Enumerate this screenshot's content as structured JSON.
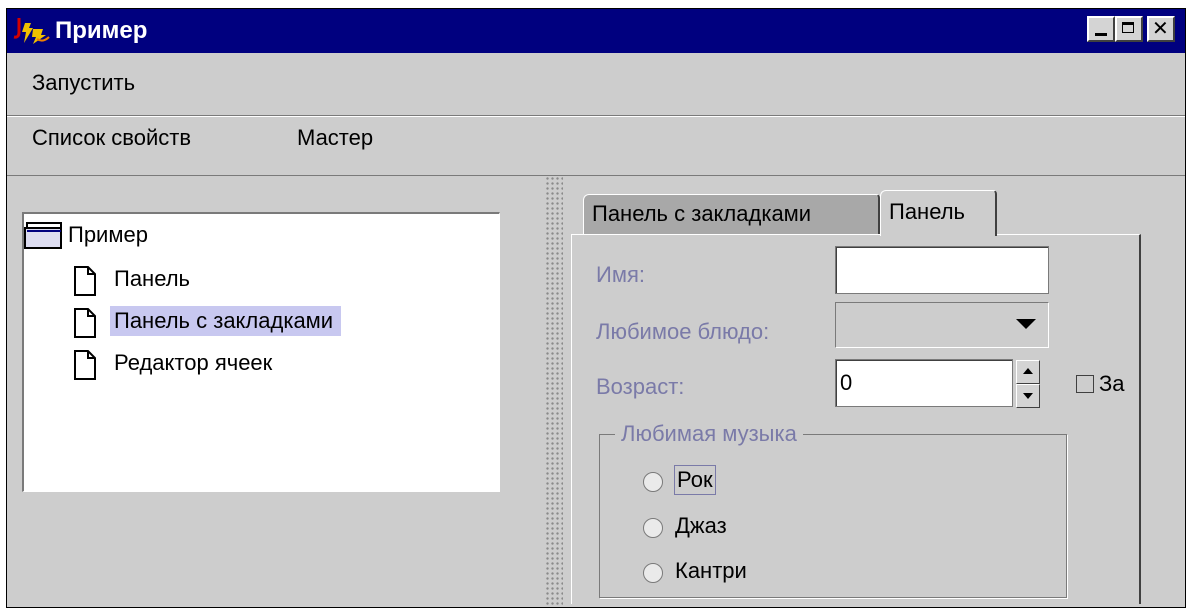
{
  "window": {
    "title": "Пример",
    "titlebar_color": "#00007f",
    "background_color": "#cdcdcd"
  },
  "menu": {
    "run_label": "Запустить"
  },
  "top_tabs": {
    "property_list_label": "Список свойств",
    "wizard_label": "Мастер"
  },
  "tree": {
    "root": "Пример",
    "items": [
      {
        "label": "Панель"
      },
      {
        "label": "Панель с закладками",
        "selected": true
      },
      {
        "label": "Редактор ячеек"
      }
    ],
    "selection_color": "#c8c8f0"
  },
  "tabs": {
    "tabbed_panel_label": "Панель с закладками",
    "panel_label": "Панель",
    "active": "Панель"
  },
  "form": {
    "name_label": "Имя:",
    "name_value": "",
    "dish_label": "Любимое блюдо:",
    "dish_value": "",
    "age_label": "Возраст:",
    "age_value": "0",
    "checkbox_label": "За",
    "checkbox_checked": false,
    "label_color": "#7a7aa8"
  },
  "music": {
    "legend": "Любимая музыка",
    "options": [
      {
        "label": "Рок",
        "checked": false,
        "focused": true
      },
      {
        "label": "Джаз",
        "checked": false
      },
      {
        "label": "Кантри",
        "checked": false
      }
    ]
  }
}
